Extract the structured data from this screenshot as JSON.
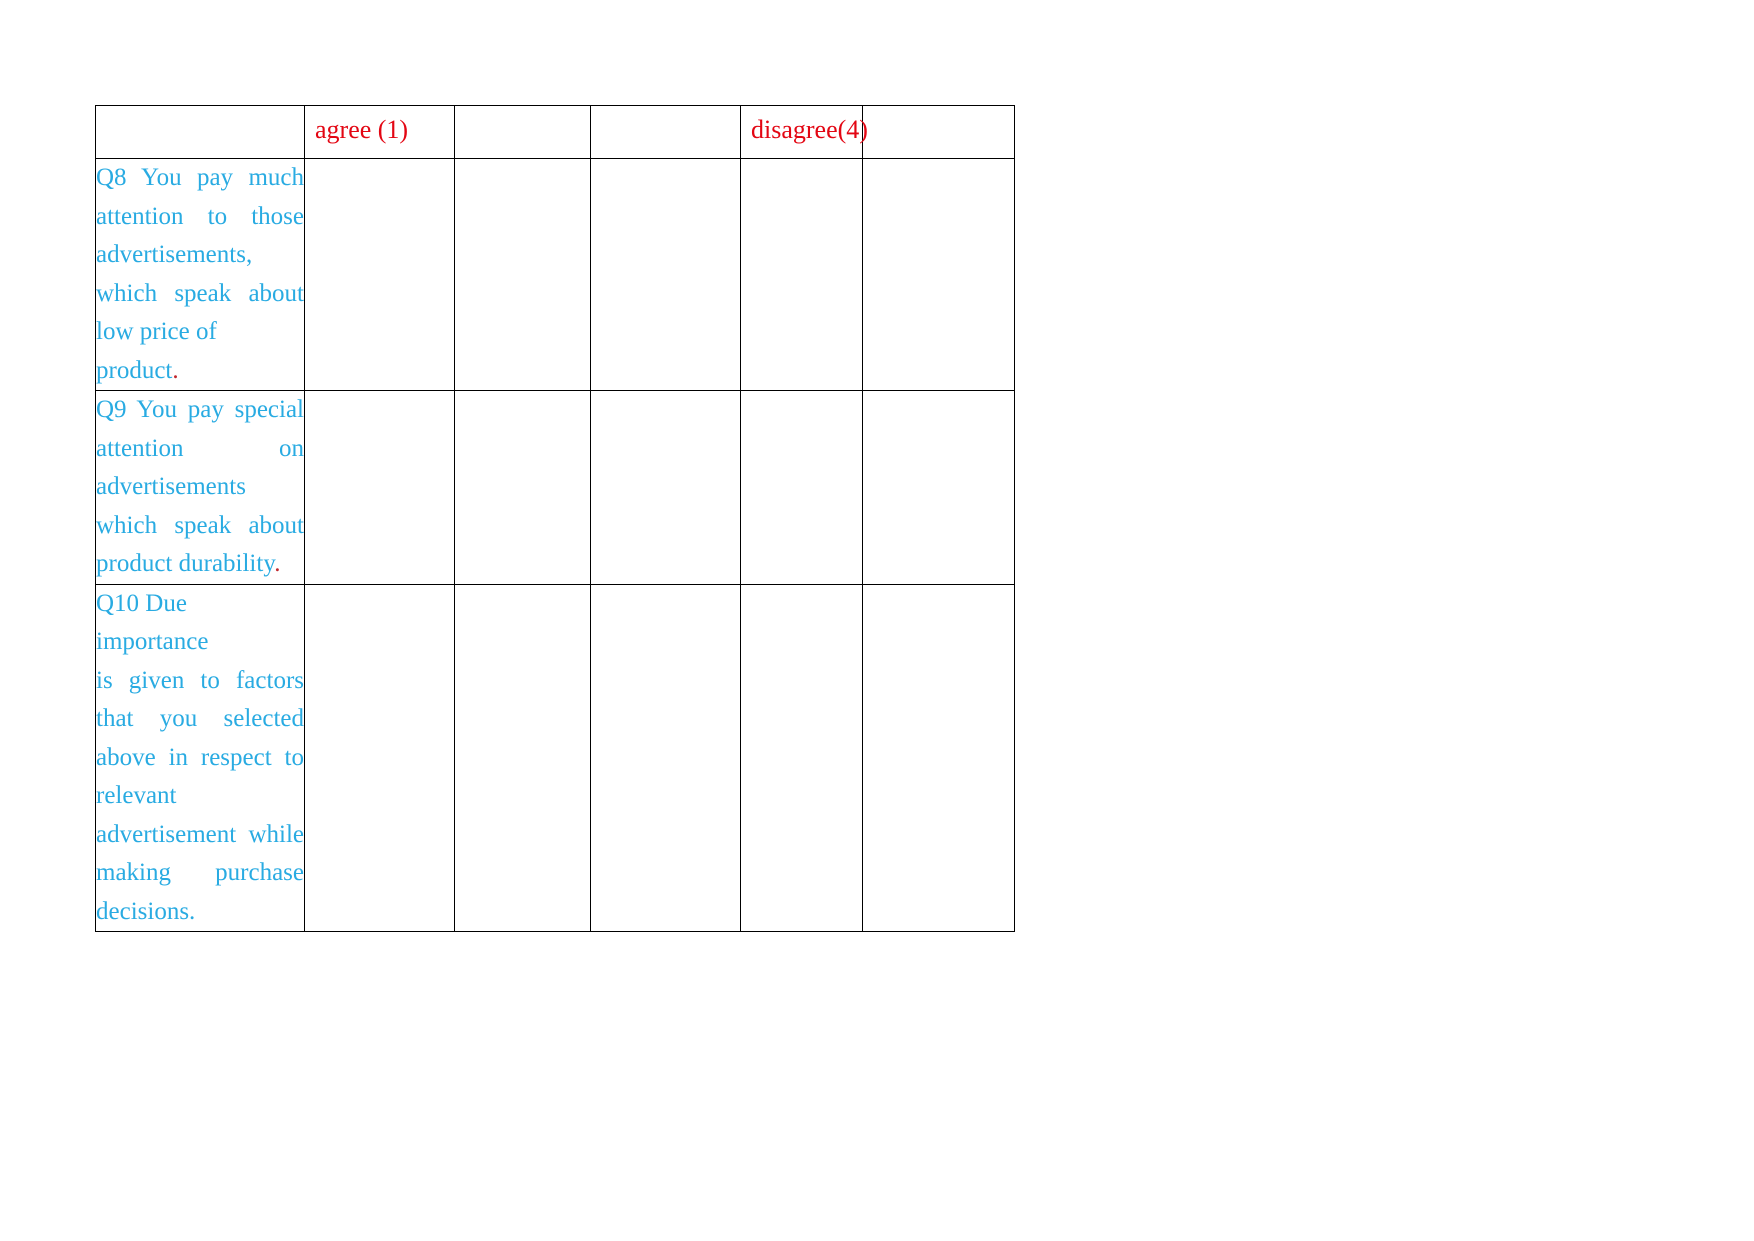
{
  "document": {
    "background_color": "#ffffff",
    "table": {
      "border_color": "#000000",
      "header_text_color": "#e30613",
      "question_text_color": "#29abe2",
      "accent_period_color": "#c1272d",
      "columns": [
        {
          "name": "question",
          "label": ""
        },
        {
          "name": "scale-1",
          "label": "agree (1)"
        },
        {
          "name": "scale-2",
          "label": ""
        },
        {
          "name": "scale-3",
          "label": ""
        },
        {
          "name": "scale-4",
          "label": "disagree(4)"
        },
        {
          "name": "scale-5",
          "label": ""
        }
      ],
      "rows": [
        {
          "id": "Q8",
          "full_text": "Q8 You pay much attention to those advertisements, which speak about low price of product.",
          "lines": [
            {
              "text": "Q8  You  pay  much",
              "justify": true
            },
            {
              "text": "attention  to  those",
              "justify": true
            },
            {
              "text": "advertisements,",
              "justify": false
            },
            {
              "text": "which  speak  about",
              "justify": true
            },
            {
              "text": "low price of product",
              "justify": false
            }
          ],
          "trailing_period": ".",
          "trailing_period_red": true,
          "answers": [
            "",
            "",
            "",
            "",
            ""
          ]
        },
        {
          "id": "Q9",
          "full_text": "Q9 You pay special attention on advertisements which speak about product durability.",
          "lines": [
            {
              "text": "Q9  You  pay  special",
              "justify": true
            },
            {
              "text": "attention  on",
              "justify": true
            },
            {
              "text": "advertisements",
              "justify": false
            },
            {
              "text": "which  speak  about",
              "justify": true
            },
            {
              "text": "product durability",
              "justify": false
            }
          ],
          "trailing_period": ".",
          "trailing_period_red": true,
          "answers": [
            "",
            "",
            "",
            "",
            ""
          ]
        },
        {
          "id": "Q10",
          "full_text": "Q10 Due importance is given to factors that you selected above in respect to relevant advertisement while making purchase decisions.",
          "lines": [
            {
              "text": "Q10 Due importance",
              "justify": false
            },
            {
              "text": "is  given  to  factors",
              "justify": true
            },
            {
              "text": "that   you   selected",
              "justify": true
            },
            {
              "text": "above  in  respect  to",
              "justify": true
            },
            {
              "text": "relevant",
              "justify": false
            },
            {
              "text": "advertisement  while",
              "justify": true
            },
            {
              "text": "making     purchase",
              "justify": true
            },
            {
              "text": "decisions.",
              "justify": false
            }
          ],
          "trailing_period": "",
          "trailing_period_red": false,
          "answers": [
            "",
            "",
            "",
            "",
            ""
          ]
        }
      ]
    }
  }
}
